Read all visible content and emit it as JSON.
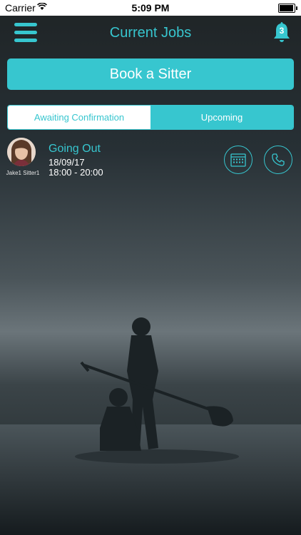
{
  "status_bar": {
    "carrier": "Carrier",
    "time": "5:09 PM"
  },
  "header": {
    "title": "Current Jobs",
    "notification_count": "3"
  },
  "book_button": {
    "label": "Book a Sitter"
  },
  "tabs": [
    {
      "label": "Awaiting Confirmation",
      "active": true
    },
    {
      "label": "Upcoming",
      "active": false
    }
  ],
  "jobs": [
    {
      "sitter_name": "Jake1 Sitter1",
      "title": "Going Out",
      "date": "18/09/17",
      "time": "18:00 - 20:00"
    }
  ],
  "icons": {
    "menu": "hamburger-menu-icon",
    "notifications": "bell-icon",
    "calendar": "calendar-icon",
    "phone": "phone-icon",
    "battery": "battery-icon",
    "wifi": "wifi-icon"
  },
  "colors": {
    "accent": "#37c6cf",
    "background": "#202628",
    "text_light": "#ffffff"
  }
}
